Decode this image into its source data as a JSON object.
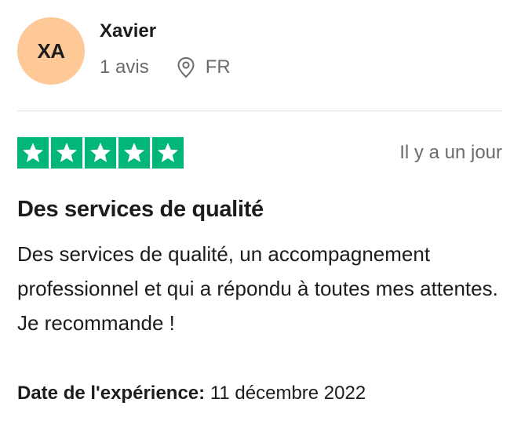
{
  "reviewer": {
    "initials": "XA",
    "name": "Xavier",
    "review_count": "1 avis",
    "country": "FR",
    "avatar_color": "#ffc897"
  },
  "rating": {
    "stars": 5,
    "max_stars": 5,
    "star_color": "#00b67a",
    "relative_date": "Il y a un jour"
  },
  "review": {
    "title": "Des services de qualité",
    "body": "Des services de qualité, un accompagnement professionnel et qui a répondu à toutes mes attentes. Je recommande !"
  },
  "experience": {
    "label": "Date de l'expérience:",
    "date": "11 décembre 2022"
  },
  "icons": {
    "location": "location-pin-icon",
    "star": "star-icon"
  }
}
